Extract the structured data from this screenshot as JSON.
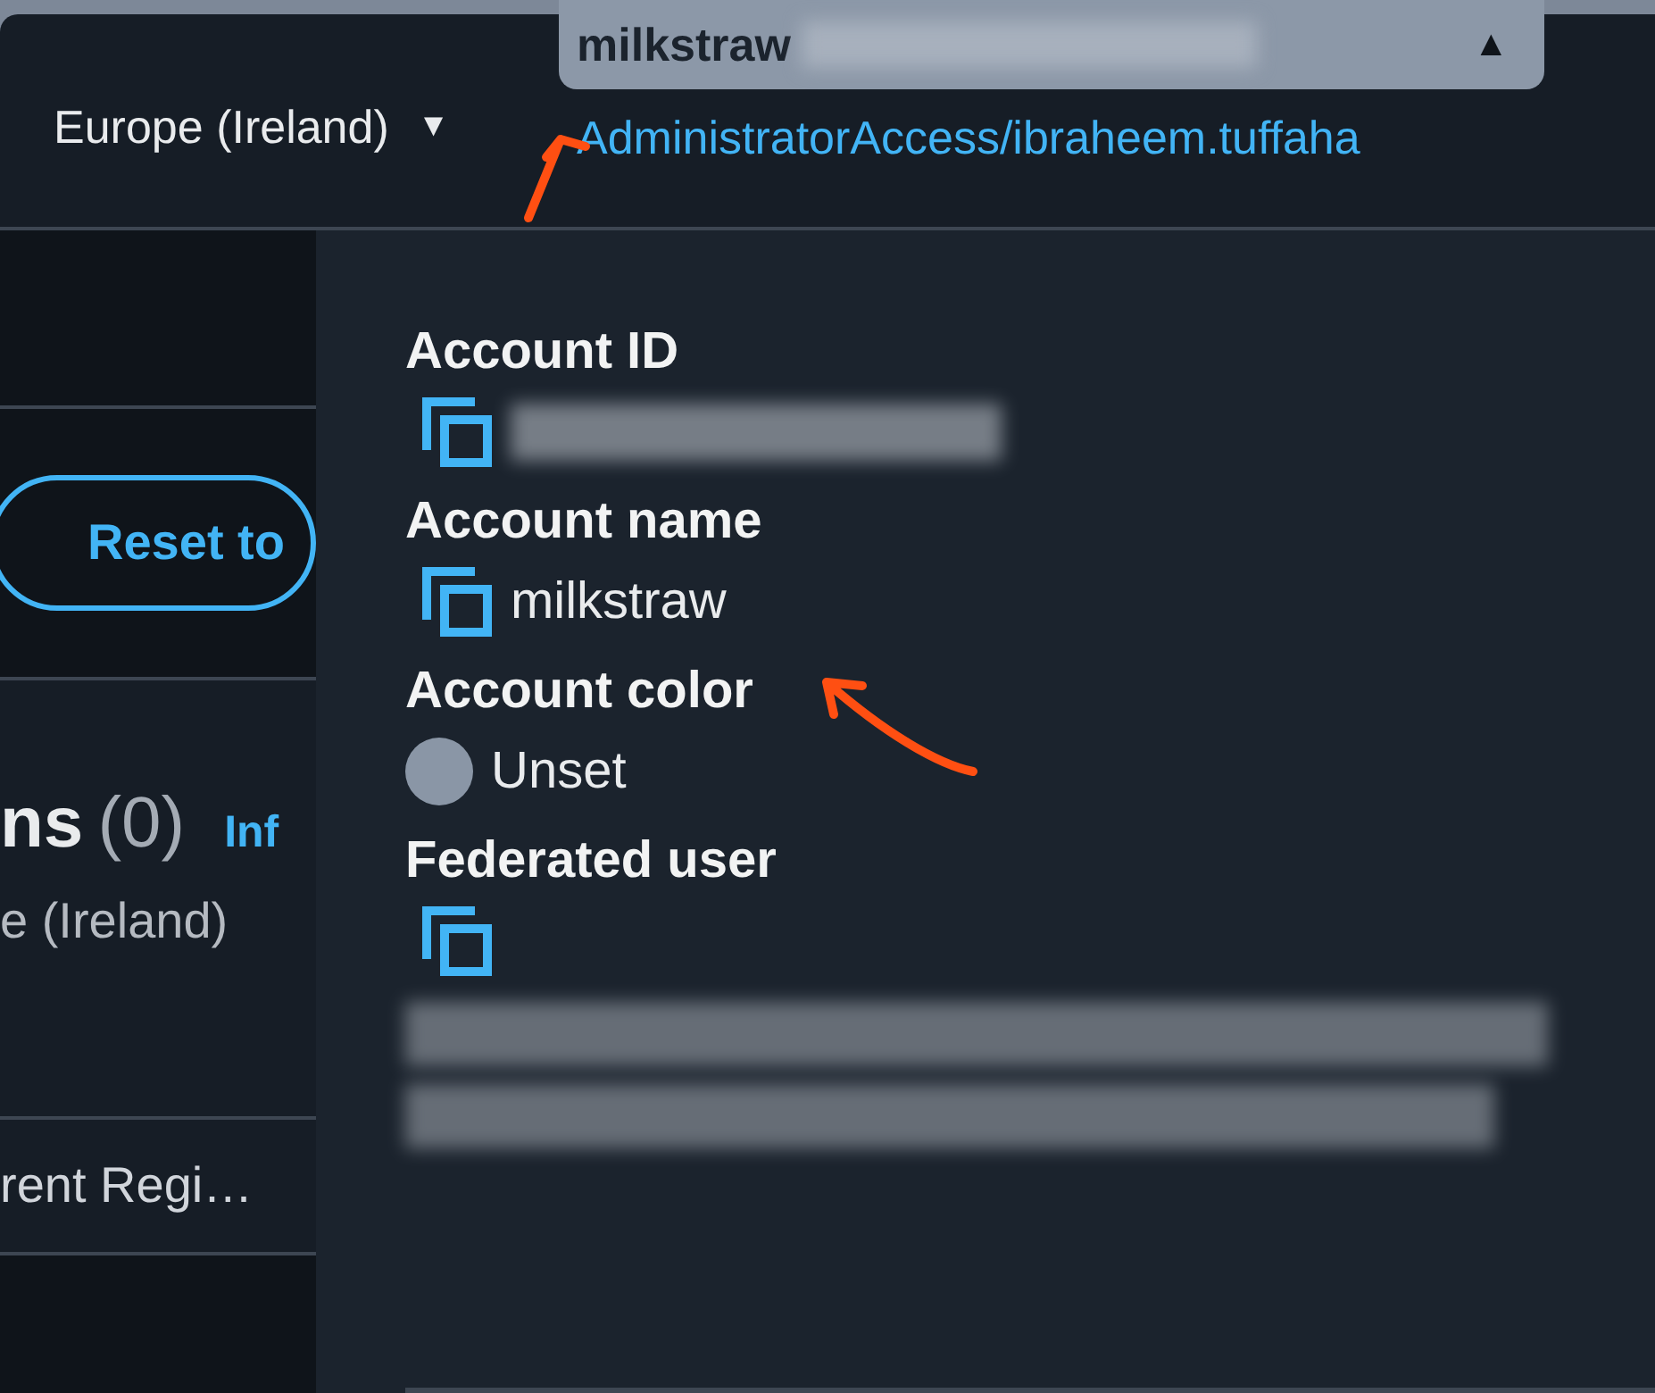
{
  "header": {
    "region": {
      "label": "Europe (Ireland)",
      "caret": "▼"
    },
    "account_menu": {
      "name": "milkstraw",
      "caret": "▲",
      "expanded": true
    },
    "role_link": "AdministratorAccess/ibraheem.tuffaha"
  },
  "page": {
    "reset_button": "Reset to",
    "heading": "ns",
    "count": "(0)",
    "info_link": "Inf",
    "subtitle": "e (Ireland)",
    "row_text": "rent Regi…"
  },
  "account_panel": {
    "fields": [
      {
        "label": "Account ID",
        "kind": "copy_redacted"
      },
      {
        "label": "Account name",
        "kind": "copy_value",
        "value": "milkstraw"
      },
      {
        "label": "Account color",
        "kind": "color",
        "value": "Unset"
      },
      {
        "label": "Federated user",
        "kind": "copy_redacted_block"
      }
    ]
  }
}
